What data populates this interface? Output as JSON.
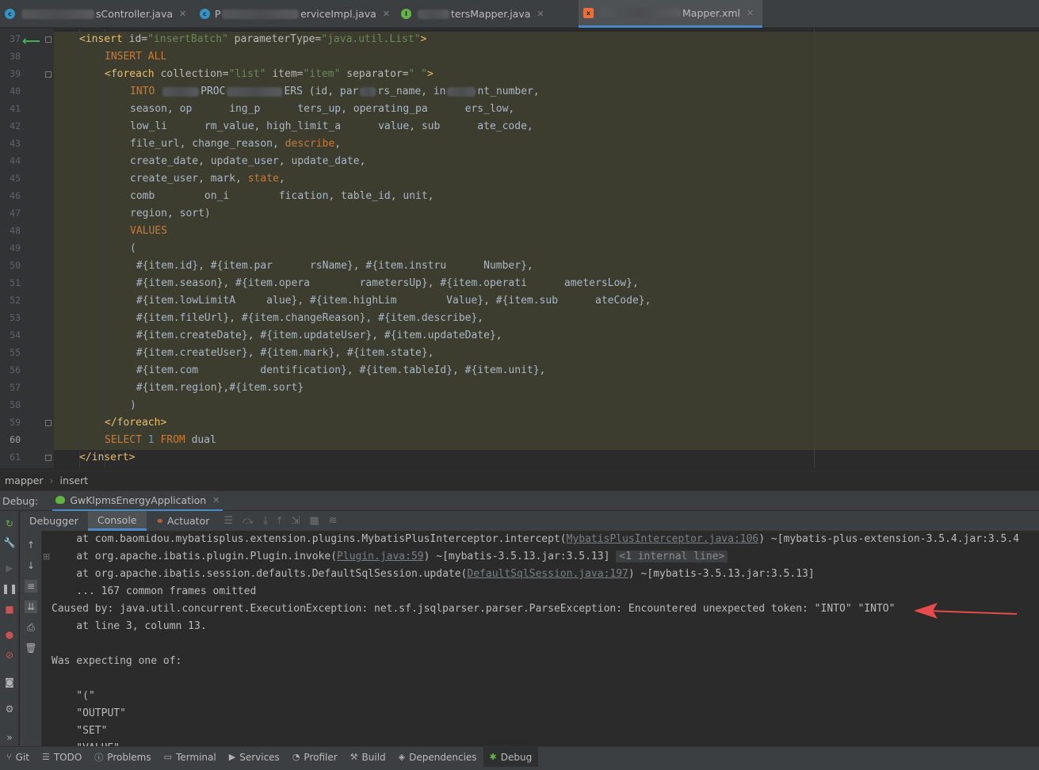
{
  "tabs": [
    {
      "icon": "class-icon",
      "prefix_blur": true,
      "label": "sController.java",
      "active": false
    },
    {
      "icon": "class-icon",
      "label_pre": "P",
      "label": "erviceImpl.java",
      "active": false
    },
    {
      "icon": "interface-icon",
      "label": "tersMapper.java",
      "active": false
    },
    {
      "icon": "xml-icon",
      "label": "Mapper.xml",
      "active": true
    }
  ],
  "editor": {
    "line_numbers": [
      "37",
      "38",
      "39",
      "40",
      "41",
      "42",
      "43",
      "44",
      "45",
      "46",
      "47",
      "48",
      "49",
      "50",
      "51",
      "52",
      "53",
      "54",
      "55",
      "56",
      "57",
      "58",
      "59",
      "60",
      "61"
    ],
    "lines": {
      "l37_open": "<insert",
      "l37_attr1": " id=",
      "l37_val1": "\"insertBatch\"",
      "l37_attr2": " parameterType=",
      "l37_val2": "\"java.util.List\"",
      "l37_close": ">",
      "l38": "INSERT ALL",
      "l39_open": "<foreach",
      "l39_attr1": " collection=",
      "l39_val1": "\"list\"",
      "l39_attr2": " item=",
      "l39_val2": "\"item\"",
      "l39_attr3": " separator=",
      "l39_val3": "\" \"",
      "l39_close": ">",
      "l40a": "INTO ",
      "l40b": "PROC",
      "l40c": "ERS (id, par",
      "l40d": "rs_name, in",
      "l40e": "nt_number,",
      "l41": "season, op      ing_p      ters_up, operating_pa      ers_low,",
      "l42": "low_li      rm_value, high_limit_a      value, sub      ate_code,",
      "l43a": "file_url, change_reason, ",
      "l43b": "describe",
      "l43c": ",",
      "l44": "create_date, update_user, update_date,",
      "l45a": "create_user, mark, ",
      "l45b": "state",
      "l45c": ",",
      "l46": "comb        on_i        fication, table_id, unit,",
      "l47": "region, sort)",
      "l48": "VALUES",
      "l49": "(",
      "l50": " #{item.id}, #{item.par      rsName}, #{item.instru      Number},",
      "l51": " #{item.season}, #{item.opera        rametersUp}, #{item.operati      ametersLow},",
      "l52": " #{item.lowLimitA     alue}, #{item.highLim        Value}, #{item.sub      ateCode},",
      "l53": " #{item.fileUrl}, #{item.changeReason}, #{item.describe},",
      "l54": " #{item.createDate}, #{item.updateUser}, #{item.updateDate},",
      "l55": " #{item.createUser}, #{item.mark}, #{item.state},",
      "l56": " #{item.com          dentification}, #{item.tableId}, #{item.unit},",
      "l57": " #{item.region},#{item.sort}",
      "l58": ")",
      "l59": "</foreach>",
      "l60a": "SELECT ",
      "l60b": "1",
      "l60c": " FROM ",
      "l60d": "dual",
      "l61": "</insert>"
    }
  },
  "breadcrumb": [
    "mapper",
    "insert"
  ],
  "debug": {
    "label": "Debug:",
    "run_config": "GwKlpmsEnergyApplication",
    "tabs": [
      "Debugger",
      "Console",
      "Actuator"
    ]
  },
  "console": {
    "c1_pre": "    at com.baomidou.mybatisplus.extension.plugins.MybatisPlusInterceptor.intercept(",
    "c1_link": "MybatisPlusInterceptor.java:106",
    "c1_post": ") ~[mybatis-plus-extension-3.5.4.jar:3.5.4",
    "c2_pre": "    at org.apache.ibatis.plugin.Plugin.invoke(",
    "c2_link": "Plugin.java:59",
    "c2_post": ") ~[mybatis-3.5.13.jar:3.5.13] ",
    "c2_note": "<1 internal line>",
    "c3_pre": "    at org.apache.ibatis.session.defaults.DefaultSqlSession.update(",
    "c3_link": "DefaultSqlSession.java:197",
    "c3_post": ") ~[mybatis-3.5.13.jar:3.5.13]",
    "c4": "    ... 167 common frames omitted",
    "c5": "Caused by: java.util.concurrent.ExecutionException: net.sf.jsqlparser.parser.ParseException: Encountered unexpected token: \"INTO\" \"INTO\"",
    "c6": "    at line 3, column 13.",
    "c7": "",
    "c8": "Was expecting one of:",
    "c9": "",
    "c10": "    \"(\"",
    "c11": "    \"OUTPUT\"",
    "c12": "    \"SET\"",
    "c13": "    \"VALUE\""
  },
  "bottom_bar": [
    {
      "icon": "git-icon",
      "label": "Git"
    },
    {
      "icon": "todo-icon",
      "label": "TODO"
    },
    {
      "icon": "problems-icon",
      "label": "Problems"
    },
    {
      "icon": "terminal-icon",
      "label": "Terminal"
    },
    {
      "icon": "services-icon",
      "label": "Services"
    },
    {
      "icon": "profiler-icon",
      "label": "Profiler"
    },
    {
      "icon": "build-icon",
      "label": "Build"
    },
    {
      "icon": "dependencies-icon",
      "label": "Dependencies"
    },
    {
      "icon": "debug-icon",
      "label": "Debug"
    }
  ],
  "colors": {
    "accent": "#4a88c7",
    "tag": "#e8bf6a",
    "keyword": "#cc7832",
    "string": "#6a8759",
    "annotation_arrow": "#e84b4b"
  }
}
